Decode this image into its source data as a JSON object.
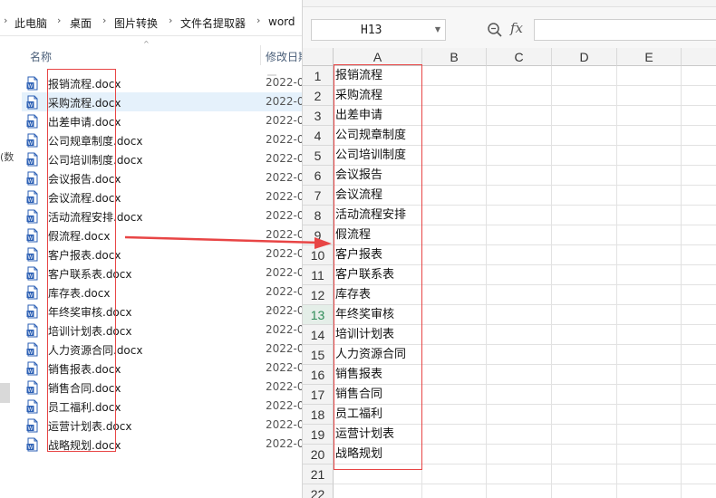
{
  "explorer": {
    "breadcrumb": [
      "此电脑",
      "桌面",
      "图片转换",
      "文件名提取器",
      "word"
    ],
    "columns": {
      "name": "名称",
      "modified": "修改日期"
    },
    "sidebar_fragment": "(数",
    "files": [
      {
        "name": "报销流程.docx",
        "date": "2022-0",
        "selected": false
      },
      {
        "name": "采购流程.docx",
        "date": "2022-0",
        "selected": true
      },
      {
        "name": "出差申请.docx",
        "date": "2022-0",
        "selected": false
      },
      {
        "name": "公司规章制度.docx",
        "date": "2022-0",
        "selected": false
      },
      {
        "name": "公司培训制度.docx",
        "date": "2022-0",
        "selected": false
      },
      {
        "name": "会议报告.docx",
        "date": "2022-0",
        "selected": false
      },
      {
        "name": "会议流程.docx",
        "date": "2022-0",
        "selected": false
      },
      {
        "name": "活动流程安排.docx",
        "date": "2022-0",
        "selected": false
      },
      {
        "name": "假流程.docx",
        "date": "2022-0",
        "selected": false
      },
      {
        "name": "客户报表.docx",
        "date": "2022-0",
        "selected": false
      },
      {
        "name": "客户联系表.docx",
        "date": "2022-0",
        "selected": false
      },
      {
        "name": "库存表.docx",
        "date": "2022-0",
        "selected": false
      },
      {
        "name": "年终奖审核.docx",
        "date": "2022-0",
        "selected": false
      },
      {
        "name": "培训计划表.docx",
        "date": "2022-0",
        "selected": false
      },
      {
        "name": "人力资源合同.docx",
        "date": "2022-0",
        "selected": false
      },
      {
        "name": "销售报表.docx",
        "date": "2022-0",
        "selected": false
      },
      {
        "name": "销售合同.docx",
        "date": "2022-0",
        "selected": false
      },
      {
        "name": "员工福利.docx",
        "date": "2022-0",
        "selected": false
      },
      {
        "name": "运营计划表.docx",
        "date": "2022-0",
        "selected": false
      },
      {
        "name": "战略规划.docx",
        "date": "2022-0",
        "selected": false
      }
    ]
  },
  "spreadsheet": {
    "name_box": "H13",
    "fx_label": "fx",
    "formula": "",
    "columns": [
      "A",
      "B",
      "C",
      "D",
      "E"
    ],
    "active_row": 13,
    "rows": [
      {
        "num": "1",
        "a": "报销流程"
      },
      {
        "num": "2",
        "a": "采购流程"
      },
      {
        "num": "3",
        "a": "出差申请"
      },
      {
        "num": "4",
        "a": "公司规章制度"
      },
      {
        "num": "5",
        "a": "公司培训制度"
      },
      {
        "num": "6",
        "a": "会议报告"
      },
      {
        "num": "7",
        "a": "会议流程"
      },
      {
        "num": "8",
        "a": "活动流程安排"
      },
      {
        "num": "9",
        "a": "假流程"
      },
      {
        "num": "10",
        "a": "客户报表"
      },
      {
        "num": "11",
        "a": "客户联系表"
      },
      {
        "num": "12",
        "a": "库存表"
      },
      {
        "num": "13",
        "a": "年终奖审核"
      },
      {
        "num": "14",
        "a": "培训计划表"
      },
      {
        "num": "15",
        "a": "人力资源合同"
      },
      {
        "num": "16",
        "a": "销售报表"
      },
      {
        "num": "17",
        "a": "销售合同"
      },
      {
        "num": "18",
        "a": "员工福利"
      },
      {
        "num": "19",
        "a": "运营计划表"
      },
      {
        "num": "20",
        "a": "战略规划"
      },
      {
        "num": "21",
        "a": ""
      },
      {
        "num": "22",
        "a": ""
      }
    ]
  },
  "annotation": {
    "color": "#e84545"
  },
  "colors": {
    "selection": "#e5f1fb",
    "word_icon": "#2b5fb4",
    "active_row_header": "#2e8b57"
  }
}
